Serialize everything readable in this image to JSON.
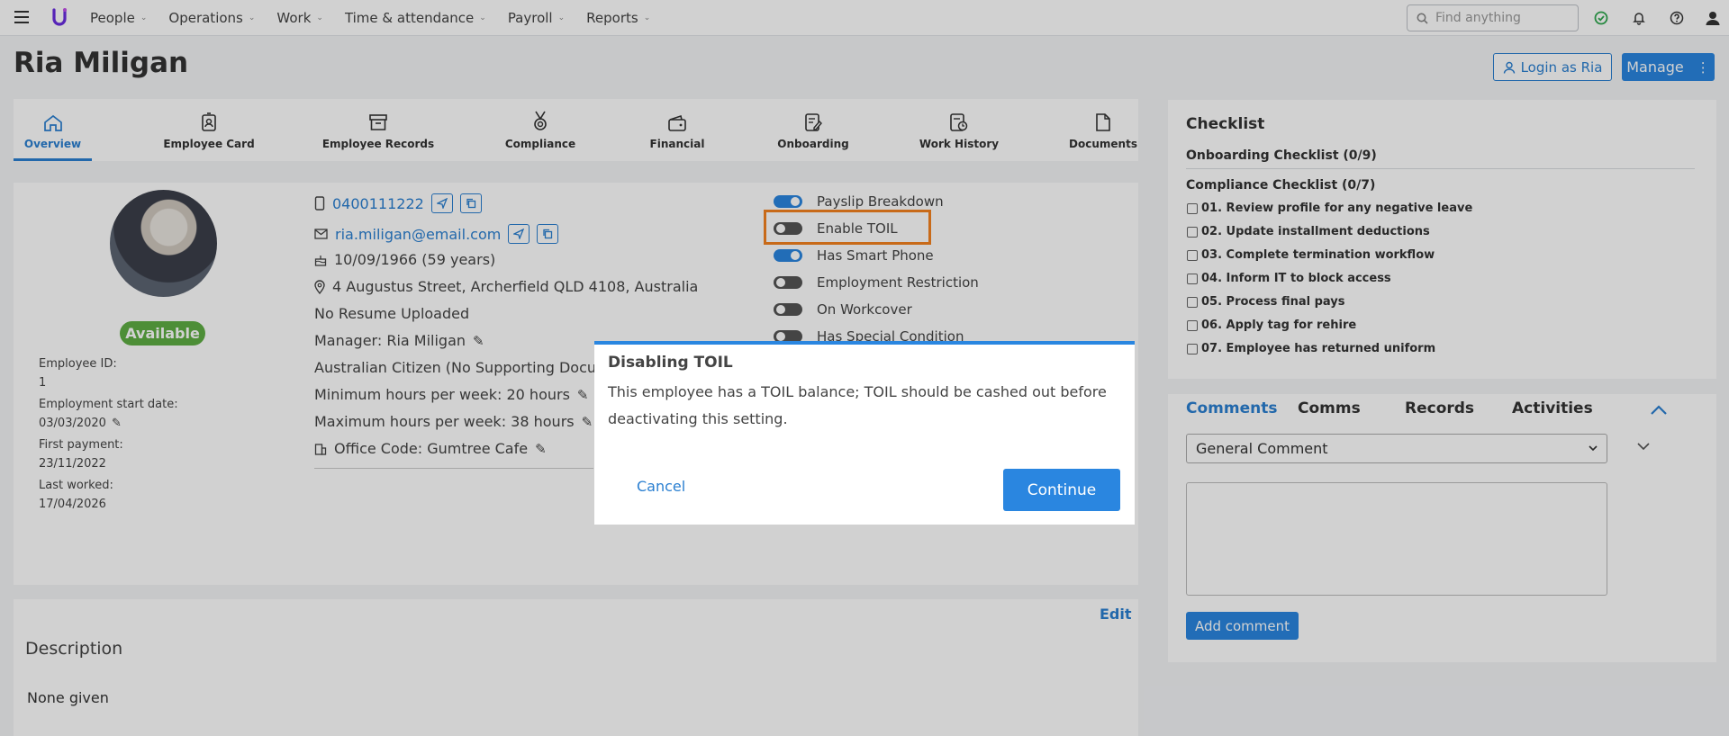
{
  "nav": {
    "items": [
      {
        "label": "People"
      },
      {
        "label": "Operations"
      },
      {
        "label": "Work"
      },
      {
        "label": "Time & attendance"
      },
      {
        "label": "Payroll"
      },
      {
        "label": "Reports"
      }
    ],
    "search_placeholder": "Find anything"
  },
  "profile": {
    "name": "Ria Miligan",
    "login_as_label": "Login as Ria",
    "manage_label": "Manage",
    "status": "Available"
  },
  "tabs": [
    {
      "label": "Overview",
      "icon": "home-icon"
    },
    {
      "label": "Employee Card",
      "icon": "id-badge-icon"
    },
    {
      "label": "Employee Records",
      "icon": "archive-box-icon"
    },
    {
      "label": "Compliance",
      "icon": "medal-icon"
    },
    {
      "label": "Financial",
      "icon": "wallet-icon"
    },
    {
      "label": "Onboarding",
      "icon": "edit-doc-icon"
    },
    {
      "label": "Work History",
      "icon": "history-doc-icon"
    },
    {
      "label": "Documents",
      "icon": "document-icon"
    }
  ],
  "info": {
    "employee_id_label": "Employee ID:",
    "employee_id": "1",
    "start_label": "Employment start date:",
    "start": "03/03/2020",
    "first_payment_label": "First payment:",
    "first_payment": "23/11/2022",
    "last_worked_label": "Last worked:",
    "last_worked": "17/04/2026"
  },
  "details": {
    "phone": "0400111222",
    "email": "ria.miligan@email.com",
    "dob": "10/09/1966 (59 years)",
    "address": "4 Augustus Street, Archerfield QLD 4108, Australia",
    "resume": "No Resume Uploaded",
    "manager": "Manager: Ria Miligan",
    "citizen": "Australian Citizen (No Supporting Docume",
    "min_hours": "Minimum hours per week: 20 hours",
    "max_hours": "Maximum hours per week: 38 hours",
    "office": "Office Code: Gumtree Cafe"
  },
  "toggles": [
    {
      "label": "Payslip Breakdown",
      "on": true
    },
    {
      "label": "Enable TOIL",
      "on": false
    },
    {
      "label": "Has Smart Phone",
      "on": true
    },
    {
      "label": "Employment Restriction",
      "on": false
    },
    {
      "label": "On Workcover",
      "on": false
    },
    {
      "label": "Has Special Condition",
      "on": false
    }
  ],
  "description": {
    "edit_label": "Edit",
    "title": "Description",
    "body": "None given"
  },
  "checklist": {
    "title": "Checklist",
    "onboarding": "Onboarding Checklist (0/9)",
    "compliance": "Compliance Checklist (0/7)",
    "items": [
      "01. Review profile for any negative leave",
      "02. Update installment deductions",
      "03. Complete termination workflow",
      "04. Inform IT to block access",
      "05. Process final pays",
      "06. Apply tag for rehire",
      "07. Employee has returned uniform"
    ]
  },
  "comments": {
    "tabs": [
      "Comments",
      "Comms",
      "Records",
      "Activities"
    ],
    "select_value": "General Comment",
    "add_label": "Add comment"
  },
  "modal": {
    "title": "Disabling TOIL",
    "body": "This employee has a TOIL balance; TOIL should be cashed out before deactivating this setting.",
    "cancel": "Cancel",
    "continue": "Continue"
  },
  "colors": {
    "accent": "#2a86e0",
    "highlight": "#f5821f",
    "status": "#5fae44"
  }
}
